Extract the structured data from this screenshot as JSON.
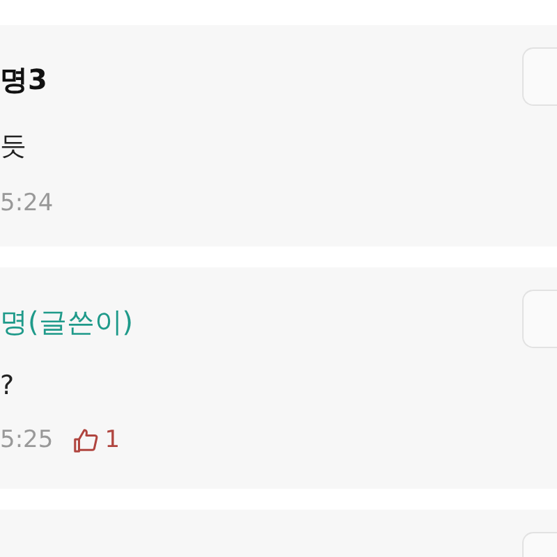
{
  "comments": [
    {
      "name": "명3",
      "author": false,
      "text": "듯",
      "time": "5:24"
    },
    {
      "name": "명(글쓴이)",
      "author": true,
      "text": "?",
      "time": "5:25",
      "likes": "1"
    }
  ]
}
